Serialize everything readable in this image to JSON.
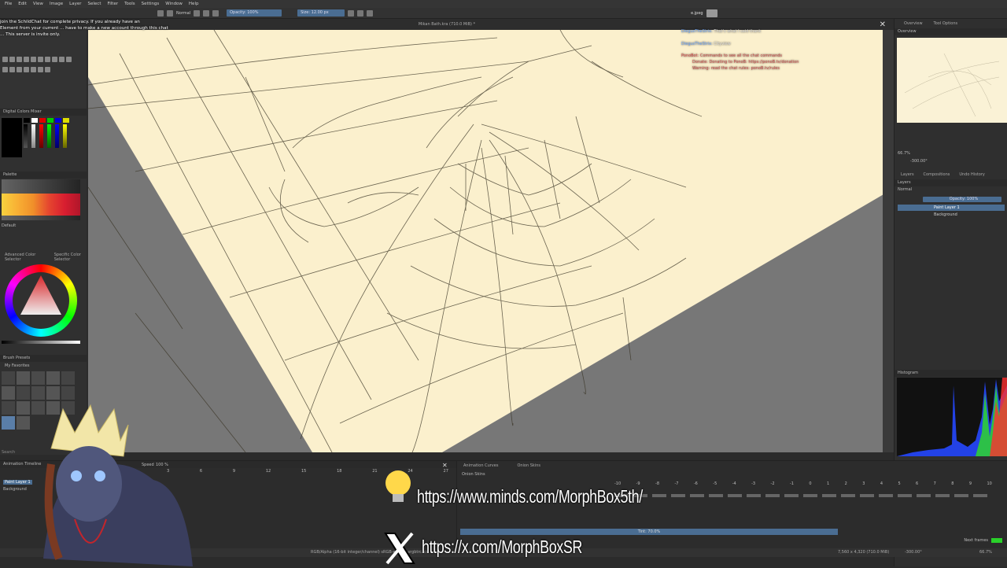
{
  "menu": [
    "File",
    "Edit",
    "View",
    "Image",
    "Layer",
    "Select",
    "Filter",
    "Tools",
    "Settings",
    "Window",
    "Help"
  ],
  "toolbar": {
    "blend_mode": "Normal",
    "opacity_label": "Opacity: 100%",
    "size_label": "Size: 12.00 px"
  },
  "document_title": "Mikan Bath.kra (710.0 MiB) *",
  "chat_left": [
    "join the SchildChat for complete privacy. If you already have an",
    "Element from your current ... have to make a new account through this chat",
    "... This server is invite only."
  ],
  "chat_right": [
    {
      "user": "DiegusTheStrix:",
      "text": "That's what I said thank",
      "color": "#6fa8ff"
    },
    {
      "user": "DiegusTheStrix:",
      "text": "Cityview",
      "color": "#6fa8ff"
    },
    {
      "user": "PonoBot:",
      "text": "Commands to see all the chat commands",
      "color": "#d04040"
    },
    {
      "user": "",
      "text": "Donate: Donating to PonoB: https://ponoB.tv/donation",
      "color": "#d04040"
    },
    {
      "user": "",
      "text": "Warning: read the chat rules: ponoB.tv/rules",
      "color": "#d04040"
    }
  ],
  "jpeg_label": "e.jpeg",
  "left_panels": {
    "digital_mixer": "Digital Colors Mixer",
    "palette": "Palette",
    "default": "Default",
    "advanced_selector": "Advanced Color Selector",
    "specific_selector": "Specific Color Selector",
    "brush_presets": "Brush Presets",
    "my_favorites": "My Favorites",
    "search": "Search"
  },
  "right_panels": {
    "overview_tab": "Overview",
    "tool_options_tab": "Tool Options",
    "overview_title": "Overview",
    "zoom": "66.7%",
    "rotation": "-300.00°",
    "layers_tab": "Layers",
    "compositions_tab": "Compositions",
    "undo_tab": "Undo History",
    "layers_title": "Layers",
    "blend": "Normal",
    "opacity": "Opacity: 100%",
    "layers": [
      "Paint Layer 1",
      "Background"
    ],
    "histogram": "Histogram"
  },
  "timeline": {
    "title": "Animation Timeline",
    "layers": [
      "Paint Layer 1",
      "Background"
    ],
    "speed": "Speed",
    "speed_value": "100 %",
    "frames": [
      "0",
      "3",
      "6",
      "9",
      "12",
      "15",
      "18",
      "21",
      "24",
      "27"
    ]
  },
  "curves": {
    "tab1": "Animation Curves",
    "tab2": "Onion Skins",
    "section": "Onion Skins",
    "numbers": [
      "-10",
      "-9",
      "-8",
      "-7",
      "-6",
      "-5",
      "-4",
      "-3",
      "-2",
      "-1",
      "0",
      "1",
      "2",
      "3",
      "4",
      "5",
      "6",
      "7",
      "8",
      "9",
      "10"
    ],
    "tint": "Tint: 70.0%",
    "next_frames": "Next frames"
  },
  "status": {
    "color_space": "RGB/Alpha (16-bit integer/channel) sRGB-elle-V2-srgbtrc.icc",
    "dims": "7,560 x 4,320 (710.0 MiB)",
    "rotation": "-300.00°",
    "zoom": "66.7%"
  },
  "social": {
    "minds": "https://www.minds.com/MorphBox5th/",
    "x": "https://x.com/MorphBoxSR"
  },
  "colors": {
    "canvas": "#fbf0cd",
    "ui_bg": "#2f2f2f",
    "accent": "#4a6d92"
  }
}
